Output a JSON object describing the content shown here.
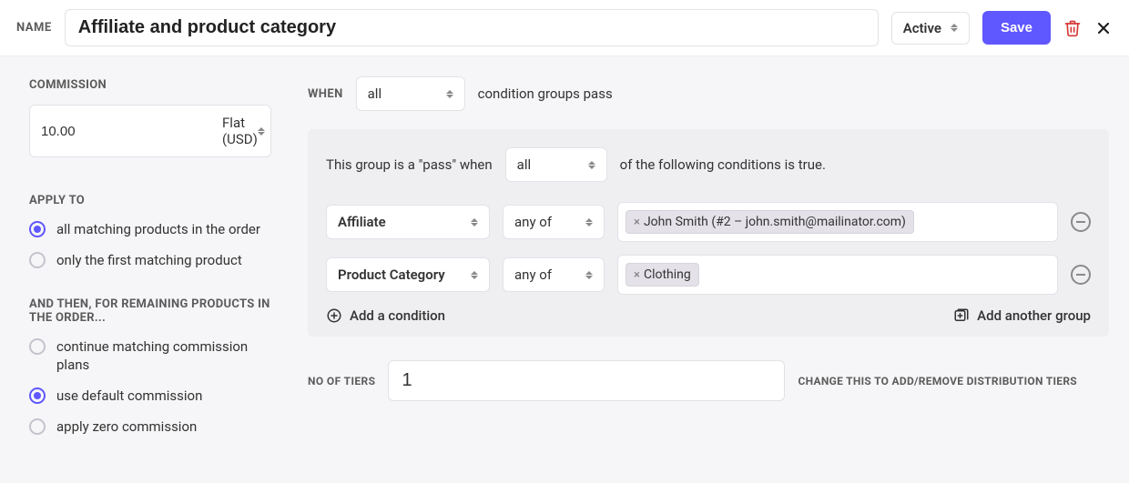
{
  "header": {
    "label": "NAME",
    "name_value": "Affiliate and product category",
    "status_value": "Active",
    "save_label": "Save"
  },
  "sidebar": {
    "commission": {
      "title": "COMMISSION",
      "amount": "10.00",
      "type": "Flat (USD)"
    },
    "apply_to": {
      "title": "APPLY TO",
      "options": [
        "all matching products in the order",
        "only the first matching product"
      ],
      "selected": 0
    },
    "remaining": {
      "title": "AND THEN, FOR REMAINING PRODUCTS IN THE ORDER...",
      "options": [
        "continue matching commission plans",
        "use default commission",
        "apply zero commission"
      ],
      "selected": 1
    }
  },
  "main": {
    "when": {
      "label": "WHEN",
      "selector": "all",
      "tail": "condition groups pass"
    },
    "group": {
      "header_pre": "This group is a \"pass\" when",
      "header_sel": "all",
      "header_post": "of the following conditions is true.",
      "conditions": [
        {
          "field": "Affiliate",
          "op": "any of",
          "tags": [
            "John Smith (#2 – john.smith@mailinator.com)"
          ]
        },
        {
          "field": "Product Category",
          "op": "any of",
          "tags": [
            "Clothing"
          ]
        }
      ],
      "add_condition": "Add a condition",
      "add_group": "Add another group"
    },
    "tiers": {
      "label": "NO OF TIERS",
      "value": "1",
      "help": "CHANGE THIS TO ADD/REMOVE DISTRIBUTION TIERS"
    }
  }
}
